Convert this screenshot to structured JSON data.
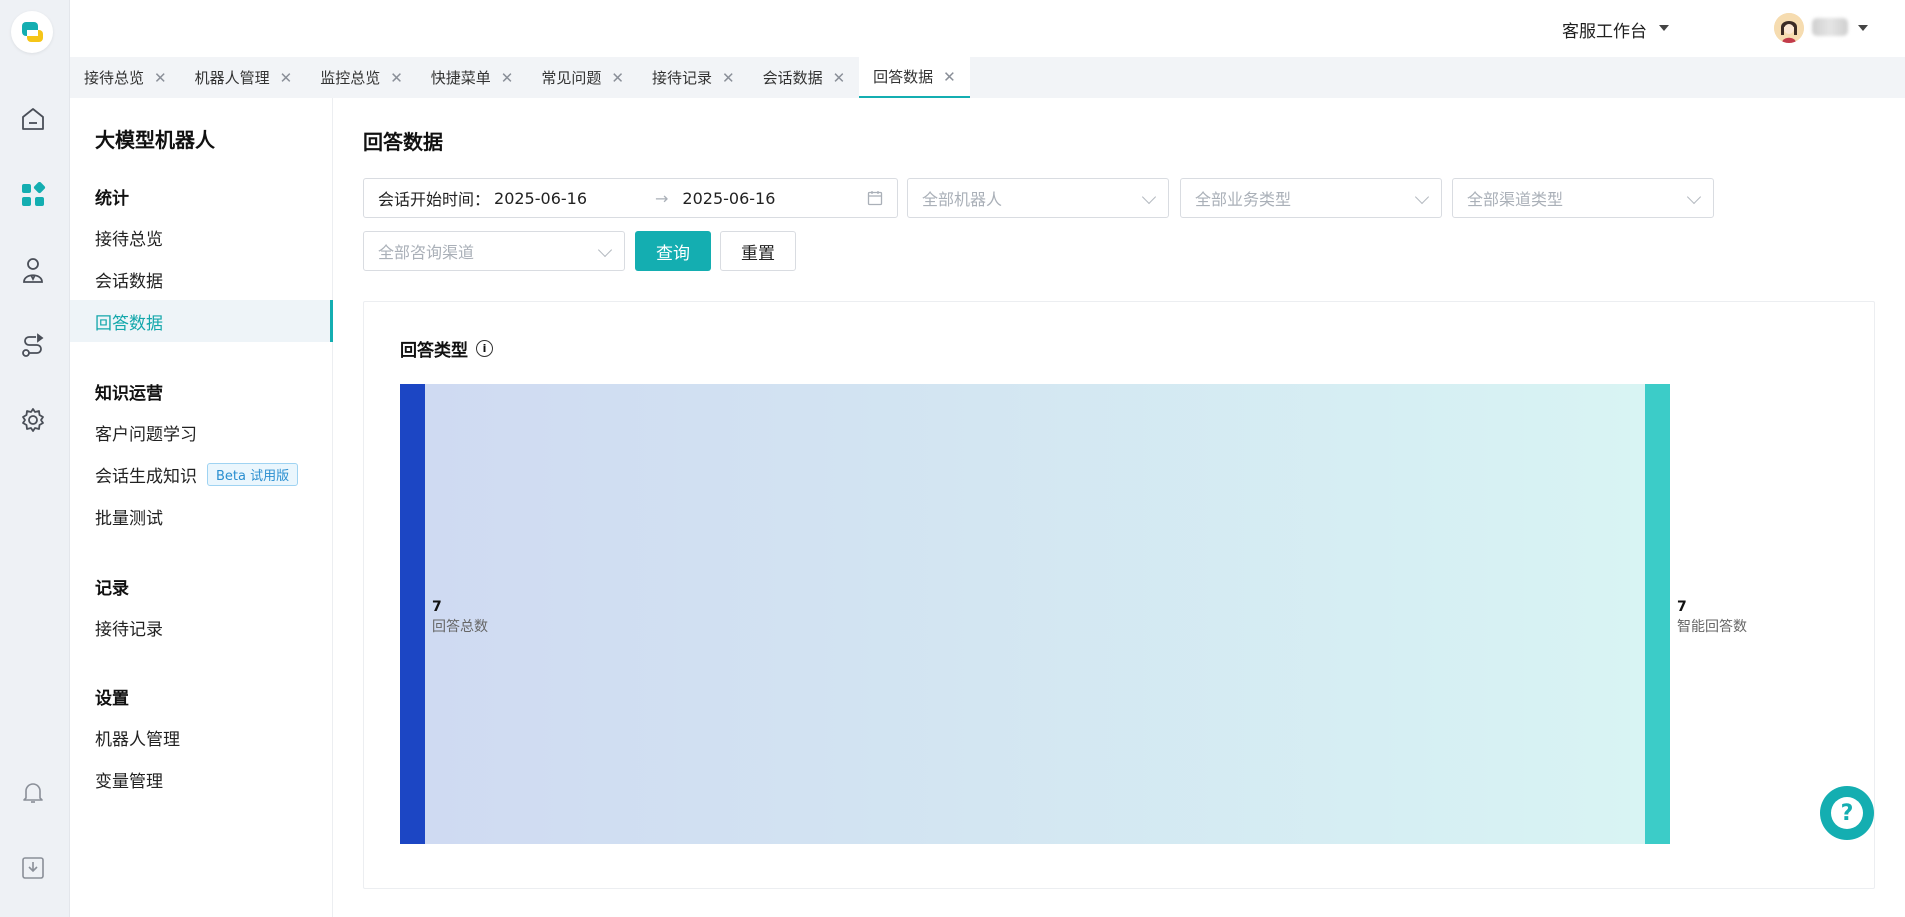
{
  "topbar": {
    "workspace": "客服工作台"
  },
  "tabs": [
    {
      "label": "接待总览"
    },
    {
      "label": "机器人管理"
    },
    {
      "label": "监控总览"
    },
    {
      "label": "快捷菜单"
    },
    {
      "label": "常见问题"
    },
    {
      "label": "接待记录"
    },
    {
      "label": "会话数据"
    },
    {
      "label": "回答数据"
    }
  ],
  "tab_close_glyph": "✕",
  "sidebar": {
    "title": "大模型机器人",
    "groups": [
      {
        "label": "统计",
        "items": [
          "接待总览",
          "会话数据",
          "回答数据"
        ]
      },
      {
        "label": "知识运营",
        "items": [
          "客户问题学习",
          "会话生成知识",
          "批量测试"
        ]
      },
      {
        "label": "记录",
        "items": [
          "接待记录"
        ]
      },
      {
        "label": "设置",
        "items": [
          "机器人管理",
          "变量管理"
        ]
      }
    ],
    "beta_badge": "Beta 试用版"
  },
  "rail_icons": [
    "home-icon",
    "apps-icon",
    "agent-icon",
    "flow-icon",
    "settings-icon",
    "bell-icon",
    "download-icon"
  ],
  "main": {
    "title": "回答数据",
    "filters": {
      "date_label": "会话开始时间：",
      "date_start": "2025-06-16",
      "date_sep": "→",
      "date_end": "2025-06-16",
      "robot_placeholder": "全部机器人",
      "business_placeholder": "全部业务类型",
      "channel_type_placeholder": "全部渠道类型",
      "consult_channel_placeholder": "全部咨询渠道"
    },
    "buttons": {
      "query": "查询",
      "reset": "重置"
    },
    "card_title": "回答类型"
  },
  "chart_data": {
    "type": "sankey",
    "nodes": [
      {
        "name": "回答总数",
        "value": 7,
        "color": "#1c46c4"
      },
      {
        "name": "智能回答数",
        "value": 7,
        "color": "#3cccc8"
      }
    ],
    "links": [
      {
        "source": "回答总数",
        "target": "智能回答数",
        "value": 7
      }
    ]
  },
  "colors": {
    "accent": "#14aeb1",
    "rail_bg": "#eef1f5",
    "tab_bar_bg": "#f2f4f7"
  }
}
